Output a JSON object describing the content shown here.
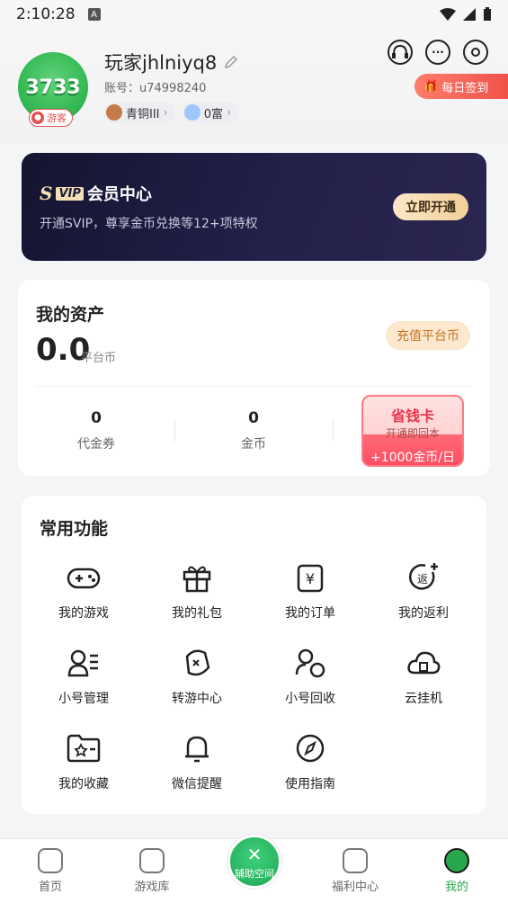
{
  "status": {
    "time": "2:10:28",
    "badge": "A"
  },
  "profile": {
    "avatar_text": "3733",
    "guest_label": "游客",
    "username": "玩家jhlniyq8",
    "account": "账号：u74998240",
    "rank_label": "青铜III",
    "wealth_label": "0富"
  },
  "header": {
    "checkin_label": "每日签到"
  },
  "svip": {
    "s_mark": "S",
    "vip_mark": "VIP",
    "title": "会员中心",
    "desc": "开通SVIP，尊享金币兑换等12+项特权",
    "button": "立即开通"
  },
  "assets": {
    "title": "我的资产",
    "balance": "0.0",
    "unit": "平台币",
    "recharge": "充值平台币",
    "stats": [
      {
        "value": "0",
        "label": "代金券"
      },
      {
        "value": "0",
        "label": "金币"
      }
    ],
    "savecard": {
      "title": "省钱卡",
      "sub": "开通即回本",
      "reward": "+1000金币/日"
    }
  },
  "functions": {
    "title": "常用功能",
    "items": [
      {
        "label": "我的游戏",
        "icon": "gamepad-icon"
      },
      {
        "label": "我的礼包",
        "icon": "gift-icon"
      },
      {
        "label": "我的订单",
        "icon": "order-icon"
      },
      {
        "label": "我的返利",
        "icon": "rebate-icon"
      },
      {
        "label": "小号管理",
        "icon": "account-manage-icon"
      },
      {
        "label": "转游中心",
        "icon": "transfer-icon"
      },
      {
        "label": "小号回收",
        "icon": "recycle-icon"
      },
      {
        "label": "云挂机",
        "icon": "cloud-icon"
      },
      {
        "label": "我的收藏",
        "icon": "favorite-icon"
      },
      {
        "label": "微信提醒",
        "icon": "bell-icon"
      },
      {
        "label": "使用指南",
        "icon": "compass-icon"
      }
    ]
  },
  "nav": {
    "items": [
      {
        "label": "首页"
      },
      {
        "label": "游戏库"
      },
      {
        "label": "福利中心"
      },
      {
        "label": "我的"
      }
    ],
    "center_label": "辅助空间"
  },
  "colors": {
    "accent": "#27a84c",
    "svip_bg": "#1c1a3a",
    "checkin": "#f0524a"
  }
}
